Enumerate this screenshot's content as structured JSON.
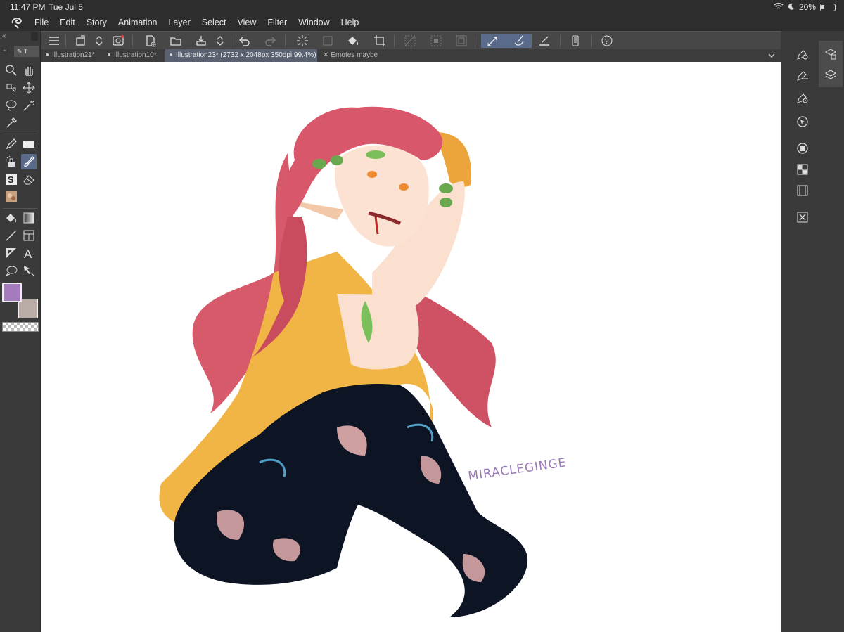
{
  "status_bar": {
    "time": "11:47 PM",
    "date": "Tue Jul 5",
    "battery": "20%"
  },
  "menu": [
    "File",
    "Edit",
    "Story",
    "Animation",
    "Layer",
    "Select",
    "View",
    "Filter",
    "Window",
    "Help"
  ],
  "tabs": [
    {
      "label": "Illustration21*"
    },
    {
      "label": "Illustration10*"
    },
    {
      "label": "Illustration23* (2732 x 2048px 350dpi 99.4%)"
    },
    {
      "label": "Emotes maybe"
    }
  ],
  "colors": {
    "main": "#a47bbd",
    "sub": "#b9aba6",
    "accent": "#5a6a8a"
  },
  "signature": "MIRACLEGINGE",
  "panel_tab_label": "T"
}
